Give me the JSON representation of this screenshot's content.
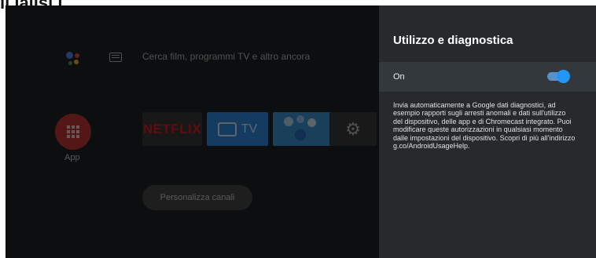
{
  "top_partial_text": "ıı ıalısı ı",
  "home": {
    "search_hint": "Cerca film, programmi TV e altro ancora",
    "apps_label": "App",
    "tiles": {
      "netflix": "NETFLIX",
      "tv": "TV"
    },
    "customize_button": "Personalizza canali",
    "icons": [
      "google-assistant-icon",
      "keyboard-icon",
      "apps-grid-icon",
      "tv-icon",
      "photos-icon",
      "gear-icon"
    ]
  },
  "panel": {
    "title": "Utilizzo e diagnostica",
    "toggle_label": "On",
    "toggle_state": true,
    "description": "Invia automaticamente a Google dati diagnostici, ad esempio rapporti sugli arresti anomali e dati sull'utilizzo del dispositivo, delle app e di Chromecast integrato. Puoi modificare queste autorizzazioni in qualsiasi momento dalle impostazioni del dispositivo. Scopri di più all'indirizzo g.co/AndroidUsageHelp.",
    "accent_color": "#2196f3"
  }
}
